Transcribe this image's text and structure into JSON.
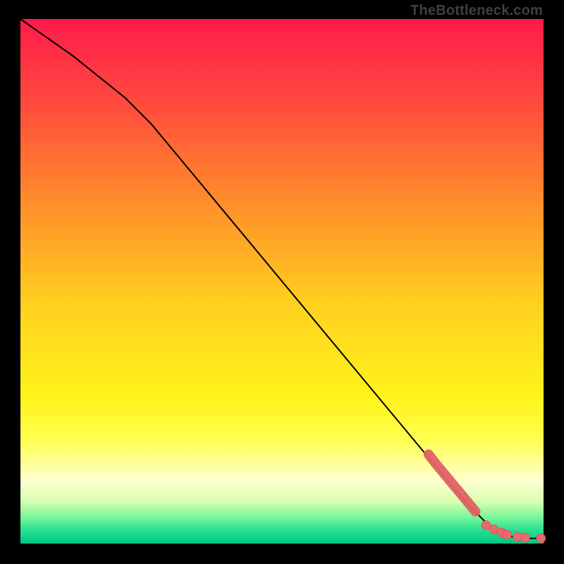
{
  "watermark": "TheBottleneck.com",
  "colors": {
    "frame": "#000000",
    "line": "#000000",
    "marker_fill": "#e96a6c",
    "marker_stroke": "#c94e52",
    "gradient_stops": [
      {
        "pos": 0.0,
        "color": "#ff1a4b"
      },
      {
        "pos": 0.16,
        "color": "#ff4a3d"
      },
      {
        "pos": 0.34,
        "color": "#ff8a2b"
      },
      {
        "pos": 0.55,
        "color": "#ffd21f"
      },
      {
        "pos": 0.72,
        "color": "#fff31a"
      },
      {
        "pos": 0.8,
        "color": "#ffff4d"
      },
      {
        "pos": 0.88,
        "color": "#ffffd0"
      },
      {
        "pos": 0.92,
        "color": "#d7ffb0"
      },
      {
        "pos": 0.95,
        "color": "#79f59a"
      },
      {
        "pos": 0.975,
        "color": "#25e090"
      },
      {
        "pos": 1.0,
        "color": "#00c884"
      }
    ]
  },
  "chart_data": {
    "type": "line",
    "title": "",
    "xlabel": "",
    "ylabel": "",
    "xlim": [
      0,
      100
    ],
    "ylim": [
      0,
      100
    ],
    "grid": false,
    "legend": false,
    "series": [
      {
        "name": "curve",
        "style": "line",
        "x": [
          0,
          10,
          20,
          25,
          30,
          40,
          50,
          60,
          70,
          80,
          85,
          88,
          90,
          92,
          95,
          100
        ],
        "y": [
          100,
          93,
          85,
          80,
          74,
          62,
          50,
          38,
          26,
          14,
          8,
          5,
          3,
          2,
          1,
          1
        ]
      },
      {
        "name": "highlight-segment",
        "style": "thick-line",
        "x": [
          78,
          79.5,
          81,
          82.5,
          84,
          85.5,
          87
        ],
        "y": [
          17.0,
          15.1,
          13.3,
          11.5,
          9.7,
          7.9,
          6.1
        ]
      },
      {
        "name": "tail-points",
        "style": "points",
        "x": [
          89,
          90.5,
          92,
          93,
          95,
          96.5,
          99.5
        ],
        "y": [
          3.5,
          2.7,
          2.1,
          1.7,
          1.3,
          1.1,
          1.0
        ]
      }
    ]
  }
}
